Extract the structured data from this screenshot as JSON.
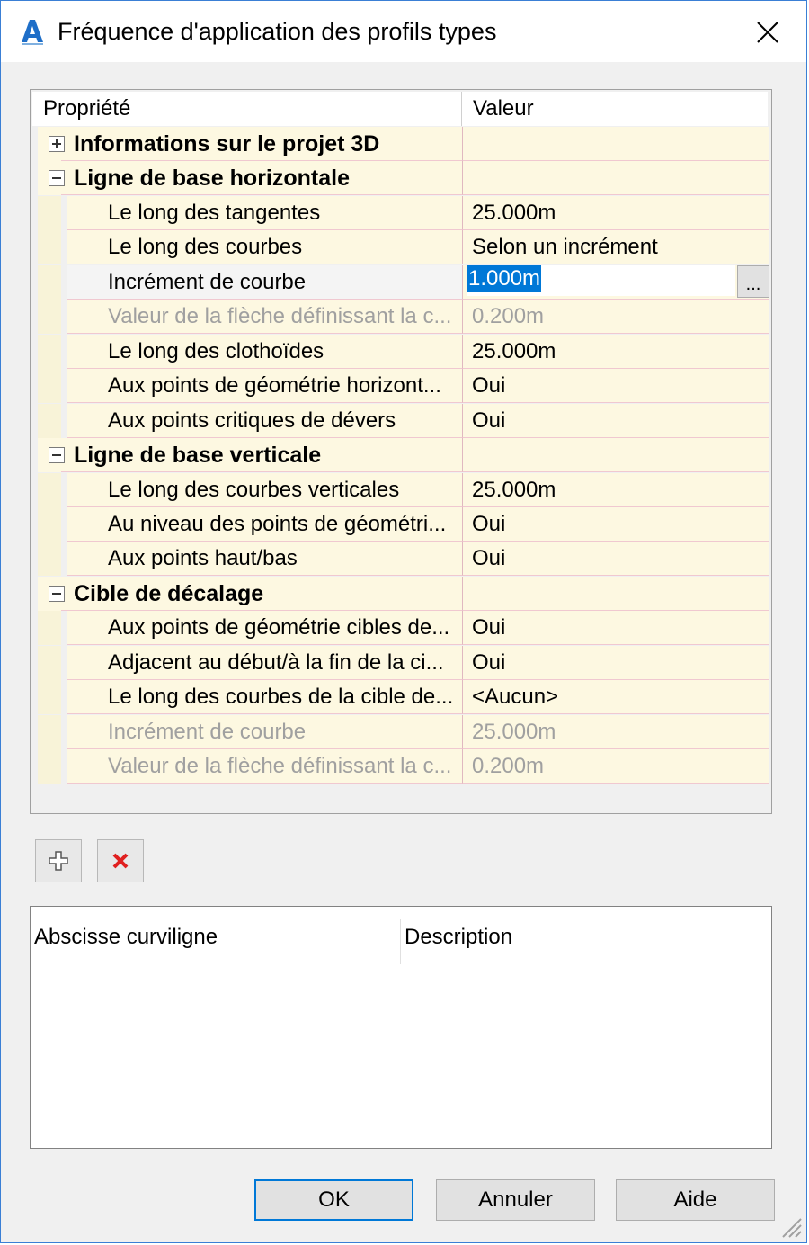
{
  "window": {
    "title": "Fréquence d'application des profils types",
    "icon": "autocad-civil-a-icon",
    "close_icon": "close-icon"
  },
  "grid": {
    "headers": {
      "property": "Propriété",
      "value": "Valeur"
    },
    "rows": [
      {
        "kind": "cat",
        "expander": "plus",
        "label": "Informations sur le projet 3D",
        "value": ""
      },
      {
        "kind": "cat",
        "expander": "minus",
        "label": "Ligne de base horizontale",
        "value": ""
      },
      {
        "kind": "child",
        "label": "Le long des tangentes",
        "value": "25.000m"
      },
      {
        "kind": "child",
        "label": "Le long des courbes",
        "value": "Selon un incrément"
      },
      {
        "kind": "child",
        "label": "Incrément de courbe",
        "value": "1.000m",
        "editing": true
      },
      {
        "kind": "child",
        "label": "Valeur de la flèche définissant la c...",
        "value": "0.200m",
        "disabled": true
      },
      {
        "kind": "child",
        "label": "Le long des clothoïdes",
        "value": "25.000m"
      },
      {
        "kind": "child",
        "label": "Aux points de géométrie horizont...",
        "value": "Oui"
      },
      {
        "kind": "child",
        "label": "Aux points critiques de dévers",
        "value": "Oui"
      },
      {
        "kind": "cat",
        "expander": "minus",
        "label": "Ligne de base verticale",
        "value": ""
      },
      {
        "kind": "child",
        "label": "Le long des courbes verticales",
        "value": "25.000m"
      },
      {
        "kind": "child",
        "label": "Au niveau des points de géométri...",
        "value": "Oui"
      },
      {
        "kind": "child",
        "label": "Aux points haut/bas",
        "value": "Oui"
      },
      {
        "kind": "cat",
        "expander": "minus",
        "label": "Cible de décalage",
        "value": ""
      },
      {
        "kind": "child",
        "label": "Aux points de géométrie cibles de...",
        "value": "Oui"
      },
      {
        "kind": "child",
        "label": "Adjacent au début/à la fin de la ci...",
        "value": "Oui"
      },
      {
        "kind": "child",
        "label": "Le long des courbes de la cible de...",
        "value": "<Aucun>"
      },
      {
        "kind": "child",
        "label": "Incrément de courbe",
        "value": "25.000m",
        "disabled": true
      },
      {
        "kind": "child",
        "label": "Valeur de la flèche définissant la c...",
        "value": "0.200m",
        "disabled": true
      }
    ],
    "ellipsis_label": "..."
  },
  "toolbar": {
    "add_icon": "add-station-icon",
    "delete_icon": "delete-station-icon"
  },
  "station_list": {
    "headers": {
      "station": "Abscisse curviligne",
      "description": "Description"
    }
  },
  "buttons": {
    "ok": "OK",
    "cancel": "Annuler",
    "help": "Aide"
  },
  "colors": {
    "row_background": "#fdf8e1",
    "selection": "#0078d7",
    "accent_border": "#3a7fd5",
    "delete_red": "#e02020"
  }
}
